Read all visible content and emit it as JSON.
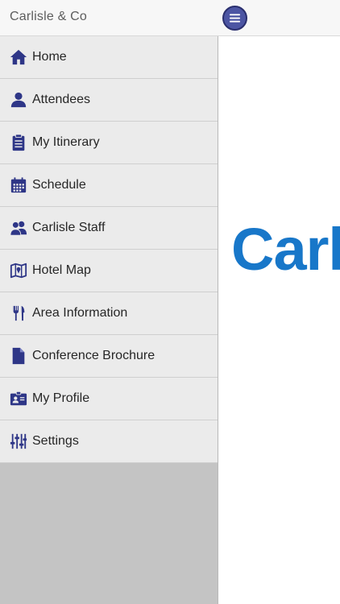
{
  "header": {
    "title": "Carlisle & Co",
    "menu_icon": "hamburger-icon",
    "menu_color": "#4c55a3"
  },
  "drawer": {
    "items": [
      {
        "label": "Home",
        "icon": "home-icon"
      },
      {
        "label": "Attendees",
        "icon": "person-icon"
      },
      {
        "label": "My Itinerary",
        "icon": "clipboard-icon"
      },
      {
        "label": "Schedule",
        "icon": "calendar-icon"
      },
      {
        "label": "Carlisle Staff",
        "icon": "people-icon"
      },
      {
        "label": "Hotel Map",
        "icon": "map-icon"
      },
      {
        "label": "Area Information",
        "icon": "fork-knife-icon"
      },
      {
        "label": "Conference Brochure",
        "icon": "document-icon"
      },
      {
        "label": "My Profile",
        "icon": "id-card-icon"
      },
      {
        "label": "Settings",
        "icon": "sliders-icon"
      }
    ],
    "icon_color": "#2e3687"
  },
  "main": {
    "brand_text": "Carl",
    "brand_color": "#1877c9"
  }
}
